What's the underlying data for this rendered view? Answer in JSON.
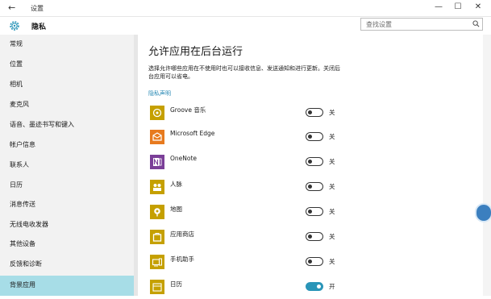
{
  "window": {
    "title": "设置",
    "back_glyph": "←",
    "minimize_glyph": "—",
    "maximize_glyph": "☐",
    "close_glyph": "✕"
  },
  "header": {
    "title": "隐私",
    "search_placeholder": "查找设置",
    "icon": "gear-icon"
  },
  "sidebar": {
    "items": [
      {
        "label": "常规"
      },
      {
        "label": "位置"
      },
      {
        "label": "相机"
      },
      {
        "label": "麦克风"
      },
      {
        "label": "语音、墨迹书写和键入"
      },
      {
        "label": "帐户信息"
      },
      {
        "label": "联系人"
      },
      {
        "label": "日历"
      },
      {
        "label": "消息传送"
      },
      {
        "label": "无线电收发器"
      },
      {
        "label": "其他设备"
      },
      {
        "label": "反馈和诊断"
      },
      {
        "label": "背景应用",
        "active": true
      }
    ]
  },
  "main": {
    "heading": "允许应用在后台运行",
    "description": "选择允许哪些应用在不使用时也可以接收信息、发送通知和进行更新。关闭后台应用可以省电。",
    "privacy_link": "隐私声明",
    "apps": [
      {
        "name": "Groove 音乐",
        "state": "关",
        "on": false,
        "icon": "groove-music-icon",
        "color": "#c5a000"
      },
      {
        "name": "Microsoft Edge",
        "state": "关",
        "on": false,
        "icon": "edge-icon",
        "color": "#e77a1e"
      },
      {
        "name": "OneNote",
        "state": "关",
        "on": false,
        "icon": "onenote-icon",
        "color": "#7b3f98"
      },
      {
        "name": "人脉",
        "state": "关",
        "on": false,
        "icon": "people-icon",
        "color": "#c5a000"
      },
      {
        "name": "地图",
        "state": "关",
        "on": false,
        "icon": "maps-icon",
        "color": "#c5a000"
      },
      {
        "name": "应用商店",
        "state": "关",
        "on": false,
        "icon": "store-icon",
        "color": "#c5a000"
      },
      {
        "name": "手机助手",
        "state": "关",
        "on": false,
        "icon": "phone-companion-icon",
        "color": "#c5a000"
      },
      {
        "name": "日历",
        "state": "开",
        "on": true,
        "icon": "calendar-icon",
        "color": "#c5a000"
      }
    ]
  },
  "colors": {
    "accent": "#2a95b8",
    "active_sidebar": "#a7dde7",
    "sidebar_bg": "#f2f2f2"
  }
}
